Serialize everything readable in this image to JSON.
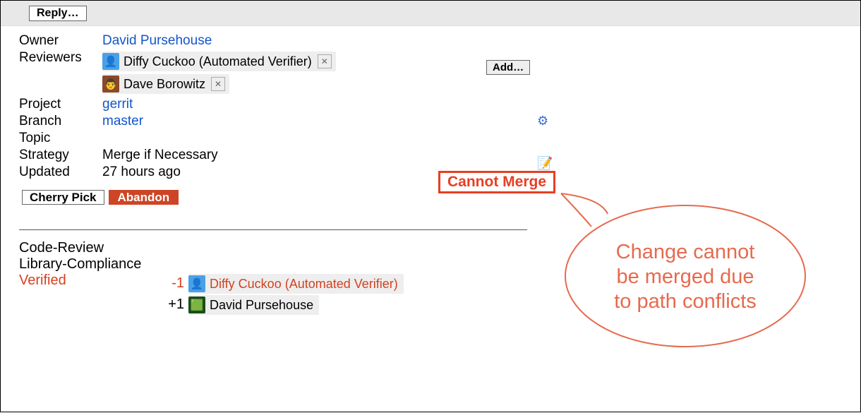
{
  "topbar": {
    "reply_label": "Reply…"
  },
  "meta": {
    "owner_label": "Owner",
    "owner_name": "David Pursehouse",
    "reviewers_label": "Reviewers",
    "reviewers": [
      {
        "name": "Diffy Cuckoo (Automated Verifier)",
        "avatar_bg": "#4aa0e6",
        "avatar_glyph": "👤"
      },
      {
        "name": "Dave Borowitz",
        "avatar_bg": "#8a4a2a",
        "avatar_glyph": "👨"
      }
    ],
    "add_label": "Add…",
    "project_label": "Project",
    "project_value": "gerrit",
    "branch_label": "Branch",
    "branch_value": "master",
    "topic_label": "Topic",
    "strategy_label": "Strategy",
    "strategy_value": "Merge if Necessary",
    "updated_label": "Updated",
    "updated_value": "27 hours ago",
    "cannot_merge": "Cannot Merge"
  },
  "actions": {
    "cherry_pick": "Cherry Pick",
    "abandon": "Abandon"
  },
  "icons": {
    "gear": "⚙",
    "edit": "📝"
  },
  "reviews": {
    "code_review_label": "Code-Review",
    "library_compliance_label": "Library-Compliance",
    "verified_label": "Verified",
    "votes": [
      {
        "score": "-1",
        "negative": true,
        "name": "Diffy Cuckoo (Automated Verifier)",
        "avatar_bg": "#4aa0e6",
        "avatar_glyph": "👤"
      },
      {
        "score": "+1",
        "negative": false,
        "name": "David Pursehouse",
        "avatar_bg": "#1a4d1a",
        "avatar_glyph": "🟩"
      }
    ]
  },
  "annotation": {
    "lines": [
      "Change cannot",
      "be merged due",
      "to path conflicts"
    ]
  }
}
